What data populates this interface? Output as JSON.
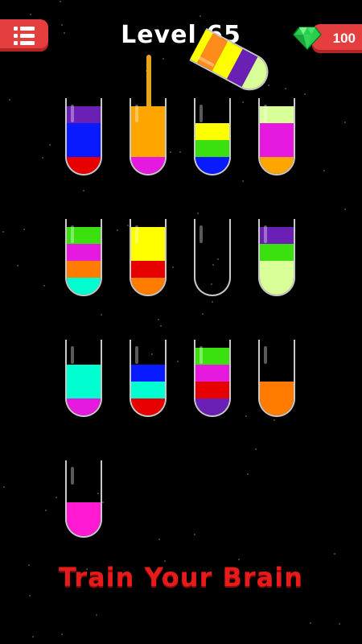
{
  "header": {
    "level_label": "Level 65",
    "gem_count": "100",
    "menu_icon": "menu-icon",
    "gem_icon": "gem-icon"
  },
  "pouring_tube": {
    "layers_top_to_bottom": [
      "#ffff00",
      "#ff8c1a",
      "#ffff00",
      "#6a1fb5",
      "#d9ff99"
    ],
    "stream_color": "#e6a51b"
  },
  "tubes": [
    {
      "layers_top_to_bottom": [
        "#6a1fb5",
        "#0a1aff",
        "#0a1aff",
        "#e60000"
      ]
    },
    {
      "layers_top_to_bottom": [
        "#ffa500",
        "#ffa500",
        "#ffa500",
        "#e61adf"
      ]
    },
    {
      "layers_top_to_bottom": [
        "#ffff00",
        "#3be00f",
        "#0a1aff"
      ]
    },
    {
      "layers_top_to_bottom": [
        "#d9ff99",
        "#e61adf",
        "#e61adf",
        "#ffa500"
      ]
    },
    {
      "layers_top_to_bottom": [
        "#3be00f",
        "#e61adf",
        "#ff7c00",
        "#00ffd0"
      ]
    },
    {
      "layers_top_to_bottom": [
        "#ffff00",
        "#ffff00",
        "#e60000",
        "#ff7c00"
      ]
    },
    {
      "layers_top_to_bottom": []
    },
    {
      "layers_top_to_bottom": [
        "#6a1fb5",
        "#3be00f",
        "#d9ff99",
        "#d9ff99"
      ]
    },
    {
      "layers_top_to_bottom": [
        "#00ffd0",
        "#00ffd0",
        "#e61adf"
      ]
    },
    {
      "layers_top_to_bottom": [
        "#0a1aff",
        "#00ffd0",
        "#e60000"
      ]
    },
    {
      "layers_top_to_bottom": [
        "#3be00f",
        "#e61adf",
        "#e60000",
        "#6a1fb5"
      ]
    },
    {
      "layers_top_to_bottom": [
        "#ff7c00",
        "#ff7c00"
      ]
    },
    {
      "layers_top_to_bottom": [
        "#ff1ad1",
        "#ff1ad1"
      ]
    }
  ],
  "footer": {
    "slogan": "Train Your Brain"
  }
}
